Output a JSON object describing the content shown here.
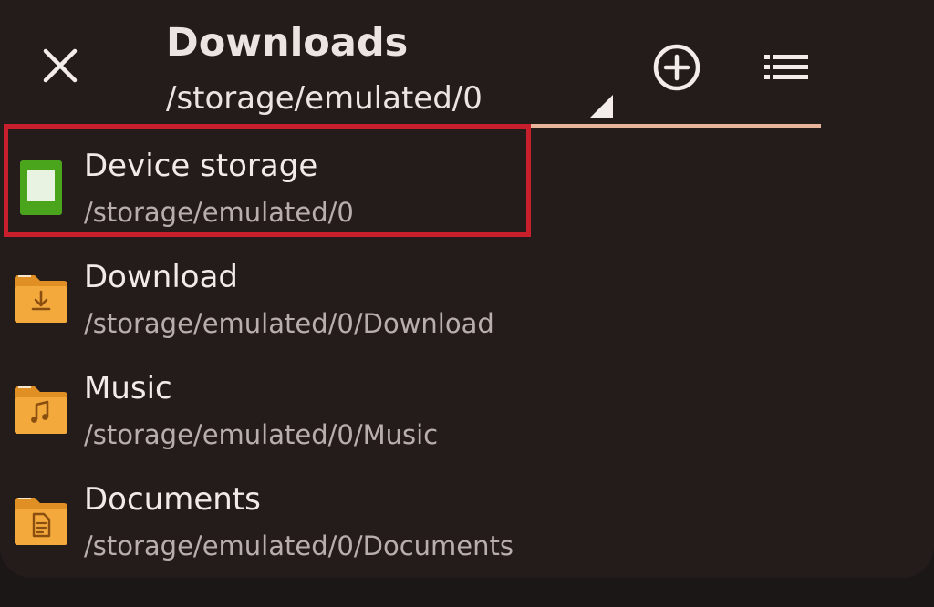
{
  "header": {
    "title": "Downloads",
    "current_path": "/storage/emulated/0",
    "close_icon": "close-icon",
    "add_icon": "add-circle-icon",
    "list_icon": "list-view-icon",
    "accent_color": "#e8b49a"
  },
  "locations": [
    {
      "name": "Device storage",
      "path": "/storage/emulated/0",
      "icon": "device-storage-icon",
      "color": "#4aa51c"
    },
    {
      "name": "Download",
      "path": "/storage/emulated/0/Download",
      "icon": "download-folder-icon",
      "color": "#f0a33a"
    },
    {
      "name": "Music",
      "path": "/storage/emulated/0/Music",
      "icon": "music-folder-icon",
      "color": "#f0a33a"
    },
    {
      "name": "Documents",
      "path": "/storage/emulated/0/Documents",
      "icon": "documents-folder-icon",
      "color": "#f0a33a"
    }
  ],
  "highlight_color": "#c81f2c"
}
